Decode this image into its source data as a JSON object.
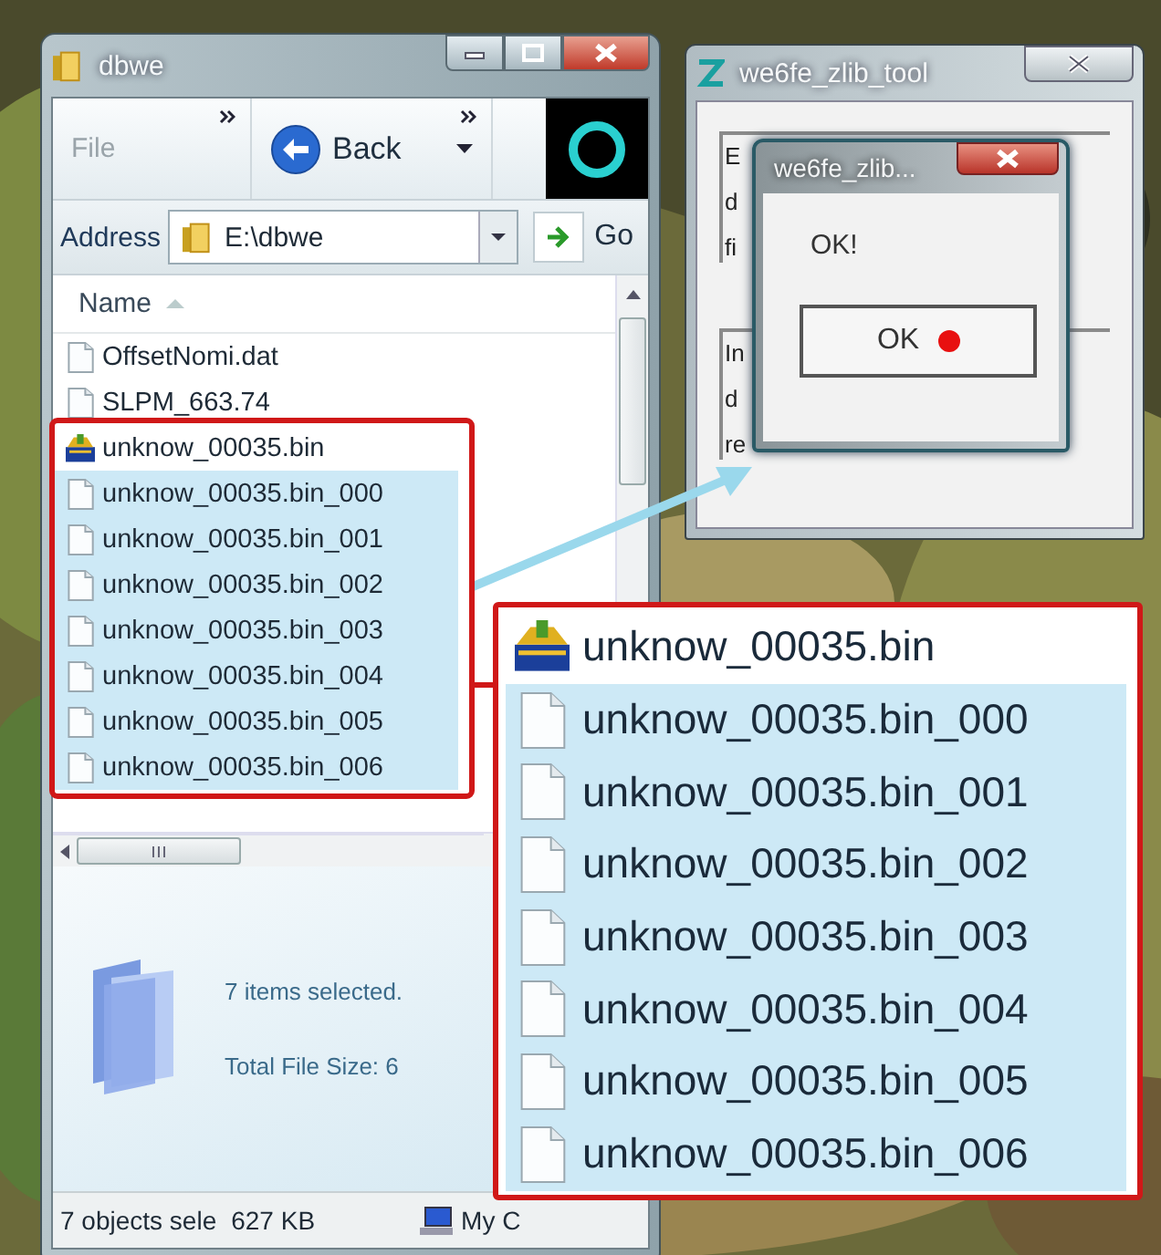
{
  "explorer": {
    "title": "dbwe",
    "menu": "File",
    "back": "Back",
    "address_label": "Address",
    "address": "E:\\dbwe",
    "go": "Go",
    "column": "Name",
    "files": [
      {
        "name": "OffsetNomi.dat",
        "kind": "page",
        "selected": false
      },
      {
        "name": "SLPM_663.74",
        "kind": "page",
        "selected": false
      },
      {
        "name": "unknow_00035.bin",
        "kind": "bin",
        "selected": false
      },
      {
        "name": "unknow_00035.bin_000",
        "kind": "page",
        "selected": true
      },
      {
        "name": "unknow_00035.bin_001",
        "kind": "page",
        "selected": true
      },
      {
        "name": "unknow_00035.bin_002",
        "kind": "page",
        "selected": true
      },
      {
        "name": "unknow_00035.bin_003",
        "kind": "page",
        "selected": true
      },
      {
        "name": "unknow_00035.bin_004",
        "kind": "page",
        "selected": true
      },
      {
        "name": "unknow_00035.bin_005",
        "kind": "page",
        "selected": true
      },
      {
        "name": "unknow_00035.bin_006",
        "kind": "page",
        "selected": true
      }
    ],
    "details": [
      "7 items selected.",
      "Total File Size: 6"
    ],
    "status": [
      "7 objects sele",
      "627 KB",
      "My C"
    ]
  },
  "tool_window": {
    "title": "we6fe_zlib_tool",
    "groups": [
      [
        "E",
        "d",
        "fi"
      ],
      [
        "In",
        "d",
        "re"
      ]
    ]
  },
  "dialog": {
    "title": "we6fe_zlib...",
    "message": "OK!",
    "button": "OK"
  },
  "zoom_inset": {
    "files": [
      {
        "name": "unknow_00035.bin",
        "kind": "bin",
        "selected": false
      },
      {
        "name": "unknow_00035.bin_000",
        "kind": "page",
        "selected": true
      },
      {
        "name": "unknow_00035.bin_001",
        "kind": "page",
        "selected": true
      },
      {
        "name": "unknow_00035.bin_002",
        "kind": "page",
        "selected": true
      },
      {
        "name": "unknow_00035.bin_003",
        "kind": "page",
        "selected": true
      },
      {
        "name": "unknow_00035.bin_004",
        "kind": "page",
        "selected": true
      },
      {
        "name": "unknow_00035.bin_005",
        "kind": "page",
        "selected": true
      },
      {
        "name": "unknow_00035.bin_006",
        "kind": "page",
        "selected": true
      }
    ]
  }
}
